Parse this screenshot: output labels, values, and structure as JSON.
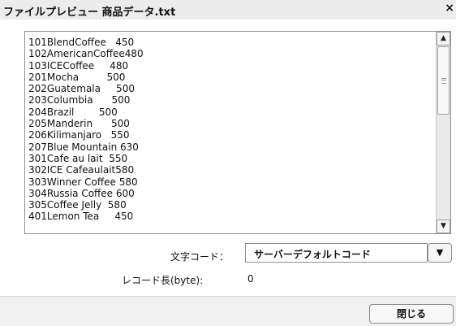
{
  "window": {
    "title": "ファイルプレビュー 商品データ.txt",
    "close_glyph": "×"
  },
  "preview": {
    "lines": [
      "101BlendCoffee   450",
      "102AmericanCoffee480",
      "103ICECoffee     480",
      "201Mocha         500",
      "202Guatemala     500",
      "203Columbia      500",
      "204Brazil        500",
      "205Manderin      500",
      "206Kilimanjaro   550",
      "207Blue Mountain 630",
      "301Cafe au lait  550",
      "302ICE Cafeaulait580",
      "303Winner Coffee 580",
      "304Russia Coffee 600",
      "305Coffee Jelly  580",
      "401Lemon Tea     450"
    ],
    "scroll_up_glyph": "▲",
    "scroll_down_glyph": "▼"
  },
  "charcode": {
    "label": "文字コード：",
    "selected": "サーバーデフォルトコード",
    "dropdown_glyph": "▼"
  },
  "record_length": {
    "label": "レコード長(byte):",
    "value": "0"
  },
  "footer": {
    "close_label": "閉じる"
  }
}
